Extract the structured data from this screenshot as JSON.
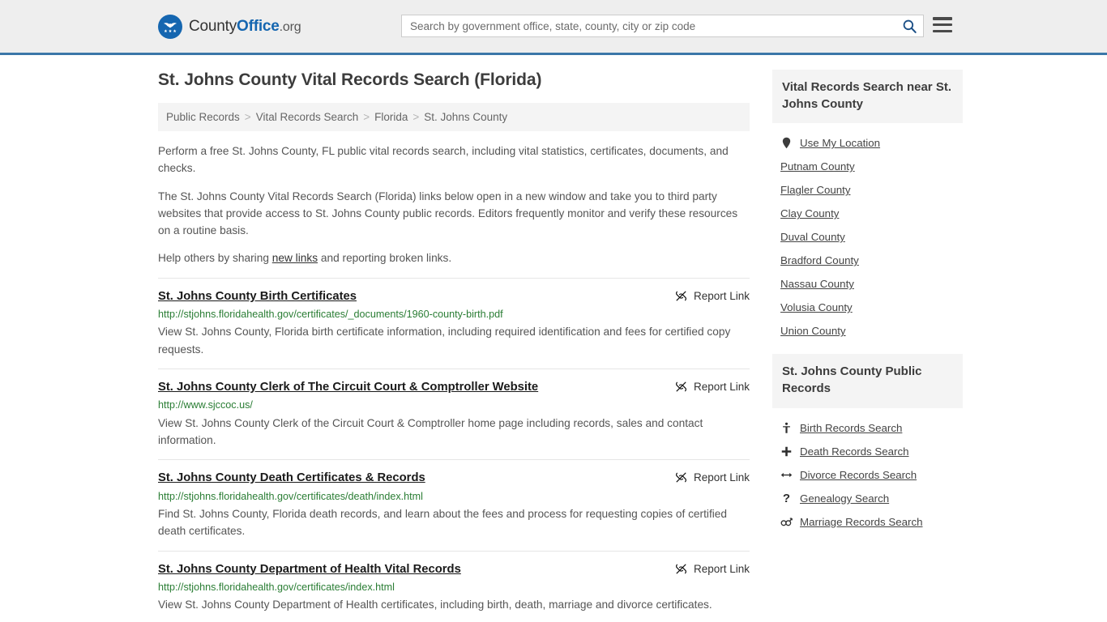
{
  "header": {
    "logo": {
      "icon": "eagle-seal-icon",
      "text_county": "County",
      "text_office": "Office",
      "text_org": ".org"
    },
    "search": {
      "placeholder": "Search by government office, state, county, city or zip code",
      "value": "",
      "search_icon": "magnifier-icon"
    },
    "menu_icon": "hamburger-menu-icon",
    "accent_color": "#3b77a8"
  },
  "page": {
    "title": "St. Johns County Vital Records Search (Florida)"
  },
  "breadcrumb": {
    "separator": ">",
    "items": [
      {
        "label": "Public Records"
      },
      {
        "label": "Vital Records Search"
      },
      {
        "label": "Florida"
      },
      {
        "label": "St. Johns County"
      }
    ]
  },
  "intro": {
    "p1": "Perform a free St. Johns County, FL public vital records search, including vital statistics, certificates, documents, and checks.",
    "p2": "The St. Johns County Vital Records Search (Florida) links below open in a new window and take you to third party websites that provide access to St. Johns County public records. Editors frequently monitor and verify these resources on a routine basis.",
    "p3_before": "Help others by sharing ",
    "p3_link": "new links",
    "p3_after": " and reporting broken links."
  },
  "results": {
    "report_label": "Report Link",
    "report_icon": "broken-chain-icon",
    "items": [
      {
        "title": "St. Johns County Birth Certificates",
        "url": "http://stjohns.floridahealth.gov/certificates/_documents/1960-county-birth.pdf",
        "description": "View St. Johns County, Florida birth certificate information, including required identification and fees for certified copy requests."
      },
      {
        "title": "St. Johns County Clerk of The Circuit Court & Comptroller Website",
        "url": "http://www.sjccoc.us/",
        "description": "View St. Johns County Clerk of the Circuit Court & Comptroller home page including records, sales and contact information."
      },
      {
        "title": "St. Johns County Death Certificates & Records",
        "url": "http://stjohns.floridahealth.gov/certificates/death/index.html",
        "description": "Find St. Johns County, Florida death records, and learn about the fees and process for requesting copies of certified death certificates."
      },
      {
        "title": "St. Johns County Department of Health Vital Records",
        "url": "http://stjohns.floridahealth.gov/certificates/index.html",
        "description": "View St. Johns County Department of Health certificates, including birth, death, marriage and divorce certificates."
      }
    ]
  },
  "sidebar": {
    "nearby": {
      "heading": "Vital Records Search near St. Johns County",
      "items": [
        {
          "label": "Use My Location",
          "icon": "map-pin-icon"
        },
        {
          "label": "Putnam County",
          "icon": ""
        },
        {
          "label": "Flagler County",
          "icon": ""
        },
        {
          "label": "Clay County",
          "icon": ""
        },
        {
          "label": "Duval County",
          "icon": ""
        },
        {
          "label": "Bradford County",
          "icon": ""
        },
        {
          "label": "Nassau County",
          "icon": ""
        },
        {
          "label": "Volusia County",
          "icon": ""
        },
        {
          "label": "Union County",
          "icon": ""
        }
      ]
    },
    "public_records": {
      "heading": "St. Johns County Public Records",
      "items": [
        {
          "label": "Birth Records Search",
          "icon": "baby-icon",
          "glyph": "\u0001"
        },
        {
          "label": "Death Records Search",
          "icon": "cross-icon",
          "glyph": "✚"
        },
        {
          "label": "Divorce Records Search",
          "icon": "double-arrow-icon",
          "glyph": "↔"
        },
        {
          "label": "Genealogy Search",
          "icon": "question-mark-icon",
          "glyph": "?"
        },
        {
          "label": "Marriage Records Search",
          "icon": "male-female-icon",
          "glyph": "⚥"
        }
      ]
    }
  },
  "colors": {
    "header_bg": "#eeeeee",
    "accent_blue": "#3b77a8",
    "url_green": "#2a7d34",
    "panel_gray": "#f4f4f4"
  }
}
